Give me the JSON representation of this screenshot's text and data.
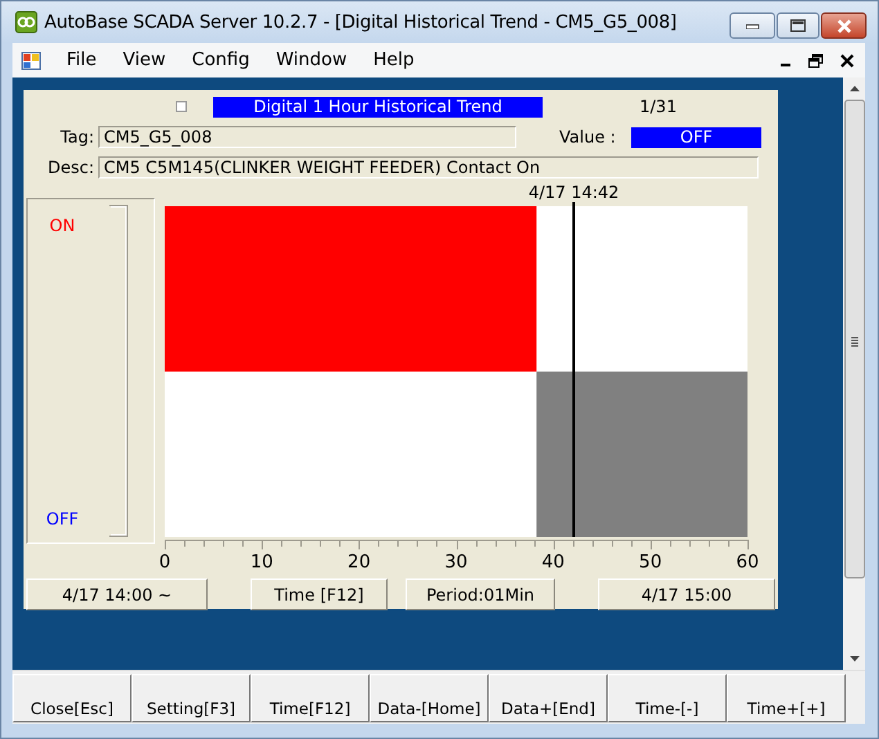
{
  "window": {
    "title": "AutoBase SCADA Server 10.2.7 - [Digital Historical Trend - CM5_G5_008]"
  },
  "menu": [
    "File",
    "View",
    "Config",
    "Window",
    "Help"
  ],
  "trend": {
    "toggle": {
      "checked": false
    },
    "heading": "Digital 1 Hour Historical Trend",
    "page": "1/31",
    "tag_label": "Tag:",
    "tag": "CM5_G5_008",
    "value_label": "Value :",
    "value": "OFF",
    "desc_label": "Desc:",
    "desc": "CM5 C5M145(CLINKER WEIGHT FEEDER) Contact On",
    "plot": {
      "state_labels": [
        {
          "label": "ON",
          "kind": "on"
        },
        {
          "label": "OFF",
          "kind": "off"
        }
      ],
      "segments": [
        {
          "kind": "on",
          "level": 0.638
        },
        {
          "kind": "off",
          "level": 0.362
        }
      ],
      "cursor": {
        "label": "4/17 14:42",
        "level": 0.7
      },
      "axis_labels": [
        "0",
        "10",
        "20",
        "30",
        "40",
        "50",
        "60"
      ]
    },
    "footer": [
      "4/17 14:00 ~",
      "Time [F12]",
      "Period:01Min",
      "4/17 15:00"
    ]
  },
  "function_keys": [
    "Close[Esc]",
    "Setting[F3]",
    "Time[F12]",
    "Data-[Home]",
    "Data+[End]",
    "Time-[-]",
    "Time+[+]"
  ]
}
